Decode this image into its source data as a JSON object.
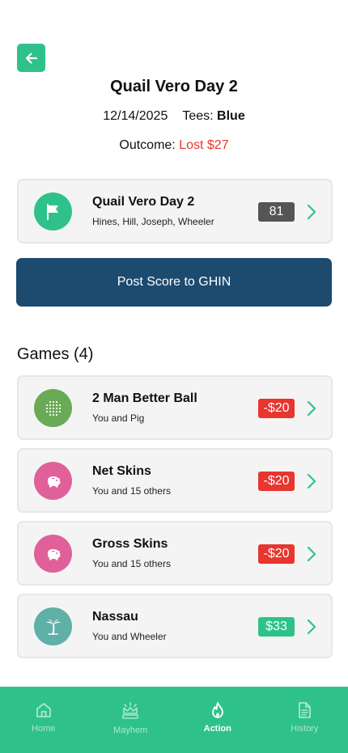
{
  "header": {
    "title": "Quail Vero Day 2",
    "date": "12/14/2025",
    "tees_label": "Tees:",
    "tees_value": "Blue",
    "outcome_label": "Outcome:",
    "outcome_value": "Lost $27"
  },
  "round_card": {
    "name": "Quail Vero Day 2",
    "players": "Hines, Hill, Joseph, Wheeler",
    "score": "81"
  },
  "ghin_button": {
    "label": "Post Score to GHIN"
  },
  "games": {
    "header": "Games (4)",
    "items": [
      {
        "name": "2 Man Better Ball",
        "sub": "You and Pig",
        "amount": "-$20",
        "icon": "dots-grid-icon"
      },
      {
        "name": "Net Skins",
        "sub": "You and 15 others",
        "amount": "-$20",
        "icon": "piggy-bank-icon"
      },
      {
        "name": "Gross Skins",
        "sub": "You and 15 others",
        "amount": "-$20",
        "icon": "piggy-bank-icon"
      },
      {
        "name": "Nassau",
        "sub": "You and Wheeler",
        "amount": "$33",
        "icon": "palm-tree-icon"
      }
    ]
  },
  "tabs": [
    {
      "label": "Home",
      "icon": "home-icon"
    },
    {
      "label": "Mayhem",
      "icon": "crown-icon"
    },
    {
      "label": "Action",
      "icon": "flame-icon",
      "active": true
    },
    {
      "label": "History",
      "icon": "document-icon"
    }
  ],
  "colors": {
    "accent": "#2ec28a",
    "navy": "#1d4a6f",
    "loss": "#e8352e",
    "score_badge": "#555555",
    "green_game": "#6aaa56",
    "pink_game": "#e0609a",
    "teal_game": "#5fb0a6"
  }
}
